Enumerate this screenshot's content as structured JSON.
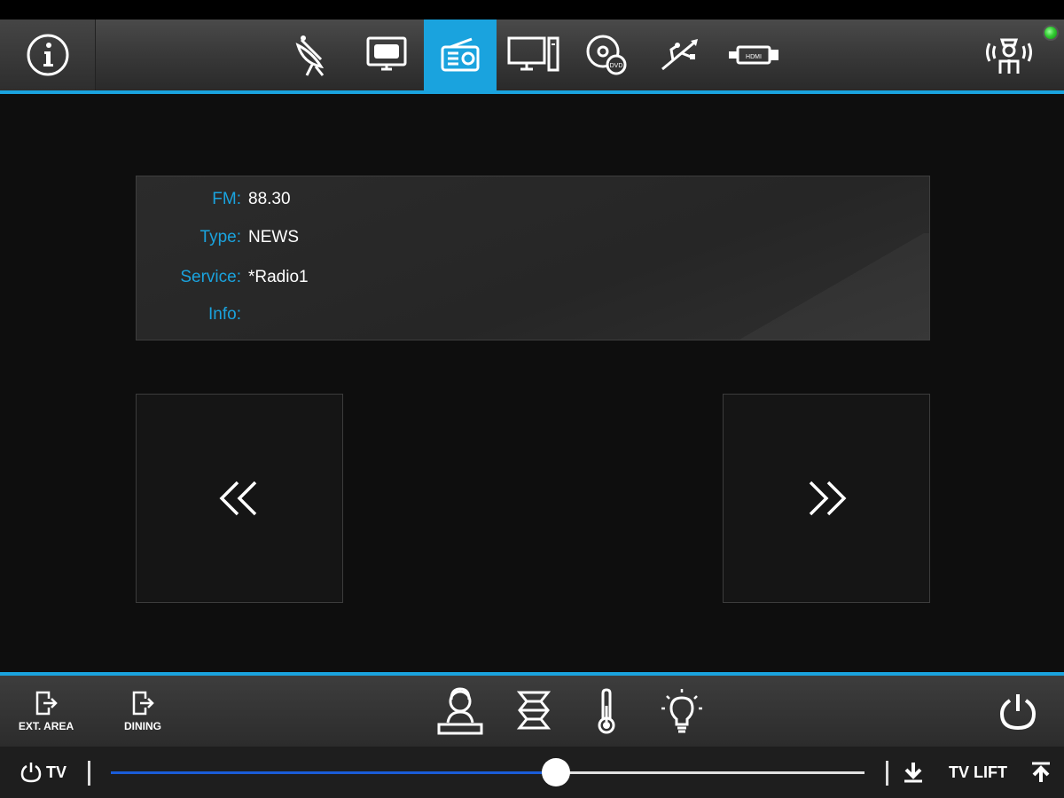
{
  "colors": {
    "accent": "#1aa3de",
    "slider_fill": "#1a5cd8",
    "status_led": "#33cc33"
  },
  "top_nav": {
    "items": [
      {
        "name": "info",
        "icon": "info-icon"
      },
      {
        "name": "satellite",
        "icon": "satellite-dish-icon"
      },
      {
        "name": "apple-tv",
        "icon": "apple-tv-icon",
        "label": "tv"
      },
      {
        "name": "radio",
        "icon": "radio-icon",
        "active": true
      },
      {
        "name": "pc",
        "icon": "computer-icon"
      },
      {
        "name": "dvd",
        "icon": "dvd-icon",
        "label": "DVD"
      },
      {
        "name": "usb",
        "icon": "usb-icon"
      },
      {
        "name": "hdmi",
        "icon": "hdmi-icon",
        "label": "HDMI"
      },
      {
        "name": "crew-call",
        "icon": "crew-call-icon"
      }
    ]
  },
  "radio_info": {
    "fm_label": "FM:",
    "fm_value": "88.30",
    "type_label": "Type:",
    "type_value": "NEWS",
    "service_label": "Service:",
    "service_value": "*Radio1",
    "info_label": "Info:",
    "info_value": ""
  },
  "controls": {
    "prev_icon": "double-chevron-left-icon",
    "next_icon": "double-chevron-right-icon"
  },
  "bottom_nav": {
    "ext_area_label": "EXT. AREA",
    "dining_label": "DINING",
    "icons": [
      "attendant-icon",
      "blinds-icon",
      "thermometer-icon",
      "light-bulb-icon",
      "power-icon"
    ]
  },
  "control_bar": {
    "tv_label": "TV",
    "lift_label": "TV LIFT",
    "volume_fraction": 0.59
  }
}
